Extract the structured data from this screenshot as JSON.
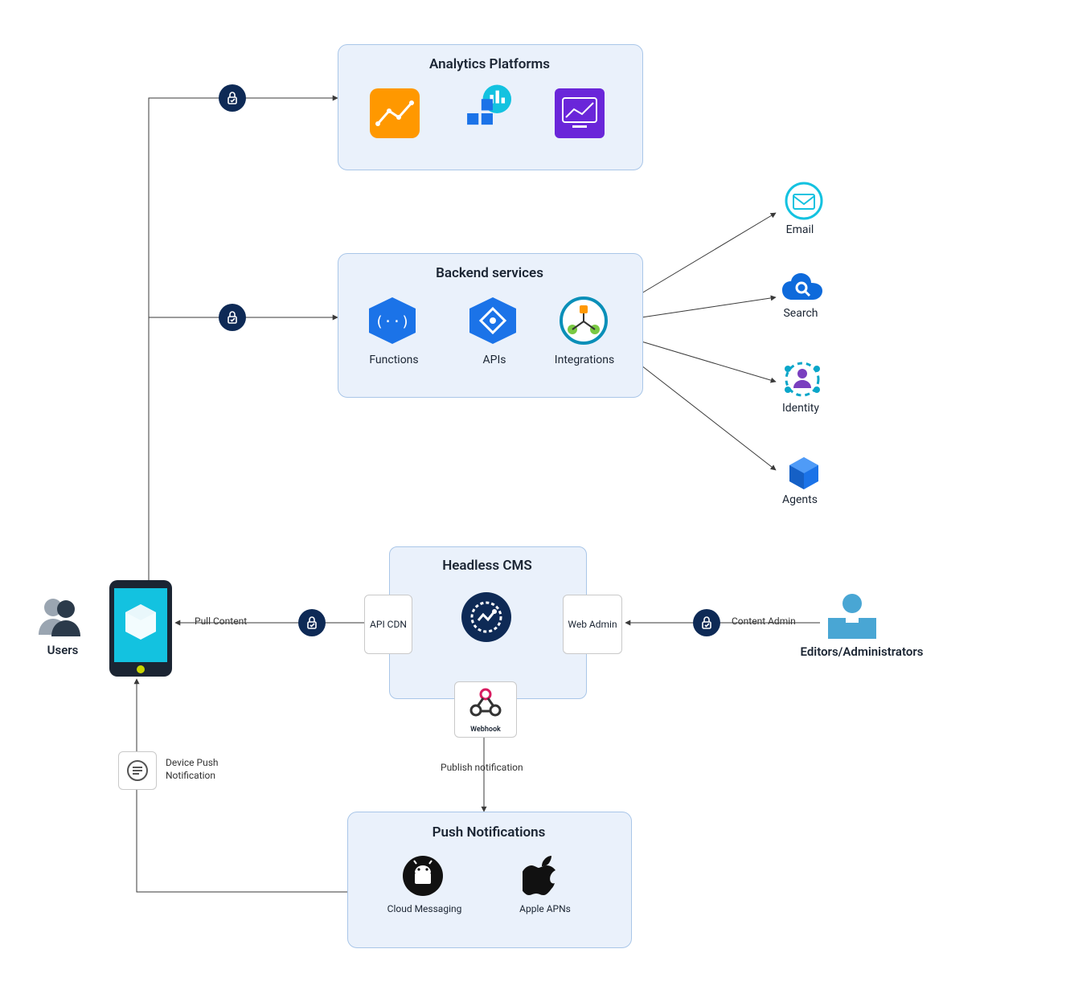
{
  "nodes": {
    "analytics": {
      "title": "Analytics Platforms"
    },
    "backend": {
      "title": "Backend services",
      "items": [
        "Functions",
        "APIs",
        "Integrations"
      ]
    },
    "cms": {
      "title": "Headless CMS",
      "api_cdn": "API CDN",
      "web_admin": "Web Admin",
      "webhook": "Webhook"
    },
    "push": {
      "title": "Push Notifications",
      "items": [
        "Cloud Messaging",
        "Apple APNs"
      ]
    },
    "users": {
      "label": "Users"
    },
    "editors": {
      "label": "Editors/Administrators"
    },
    "externals": {
      "email": {
        "label": "Email"
      },
      "search": {
        "label": "Search"
      },
      "identity": {
        "label": "Identity"
      },
      "agents": {
        "label": "Agents"
      }
    }
  },
  "edges": {
    "pull_content": "Pull Content",
    "content_admin": "Content Admin",
    "publish_notification": "Publish notification",
    "device_push": "Device Push Notification"
  },
  "colors": {
    "box_fill": "#eaf1fb",
    "box_border": "#a9c6e8",
    "lock_bg": "#0e2a56",
    "arrow": "#3a3a3a",
    "blue": "#1b73e8",
    "orange": "#ff9800",
    "purple": "#6a26d9",
    "cms_circle": "#0e2a56",
    "android": "#111111",
    "apple": "#111111",
    "webhook_accent": "#d81b60",
    "search_cloud": "#0e6adb",
    "identity_ring": "#0aa6c9",
    "agent_cube": "#1b73e8"
  }
}
